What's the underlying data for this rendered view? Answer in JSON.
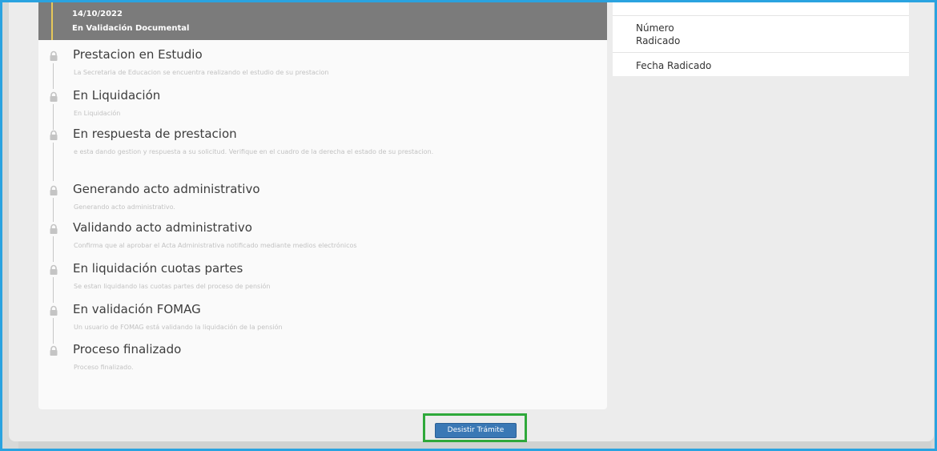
{
  "current_status": {
    "date": "14/10/2022",
    "state": "En Validación Documental"
  },
  "steps": [
    {
      "title": "Prestacion en Estudio",
      "desc": "La Secretaria de Educacion se encuentra realizando el estudio de su prestacion"
    },
    {
      "title": "En Liquidación",
      "desc": "En Liquidación"
    },
    {
      "title": "En respuesta de prestacion",
      "desc": "e esta dando gestion y respuesta a su solicitud. Verifique en el cuadro de la derecha el estado de su prestacion."
    },
    {
      "title": "Generando acto administrativo",
      "desc": "Generando acto administrativo."
    },
    {
      "title": "Validando acto administrativo",
      "desc": "Confirma que al aprobar el Acta Administrativa notificado mediante medios electrónicos"
    },
    {
      "title": "En liquidación cuotas partes",
      "desc": "Se estan liquidando las cuotas partes del proceso de pensión"
    },
    {
      "title": "En validación FOMAG",
      "desc": "Un usuario de FOMAG está validando la liquidación de la pensión"
    },
    {
      "title": "Proceso finalizado",
      "desc": "Proceso finalizado."
    }
  ],
  "info": {
    "numero_radicado_label": "Número Radicado",
    "fecha_radicado_label": "Fecha Radicado"
  },
  "actions": {
    "desistir_label": "Desistir Trámite"
  },
  "colors": {
    "highlight_border": "#2ea83a",
    "button": "#3a78b5",
    "window_border": "#2aa3e0"
  }
}
